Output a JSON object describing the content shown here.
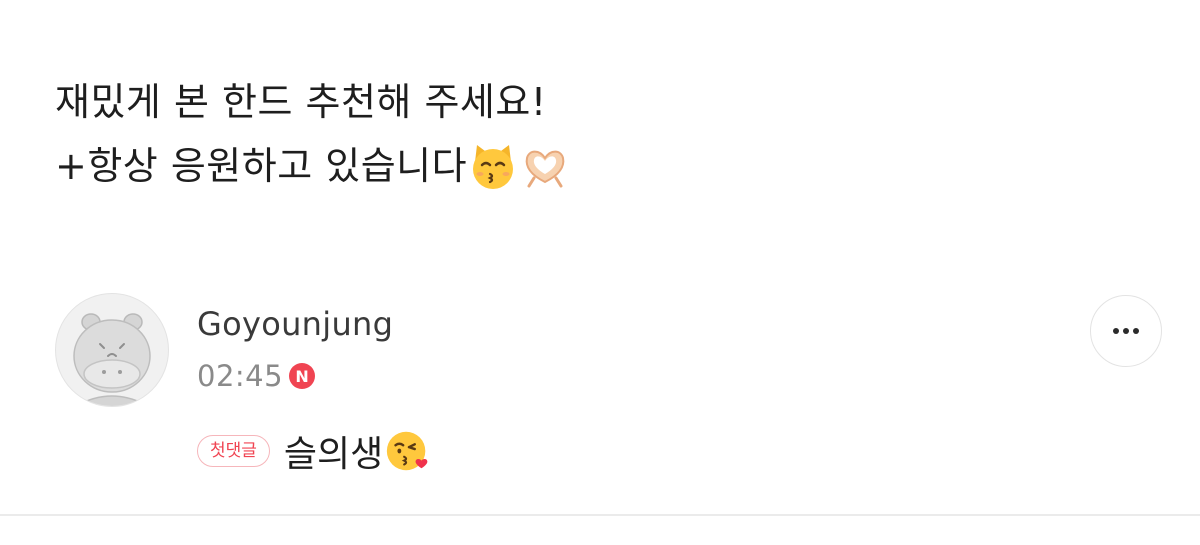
{
  "post": {
    "line1": "재밌게 본 한드 추천해 주세요!",
    "line2": "+항상 응원하고 있습니다"
  },
  "comment": {
    "author": "Goyounjung",
    "time": "02:45",
    "new_badge": "N",
    "first_comment_badge": "첫댓글",
    "text": "슬의생"
  },
  "icons": [
    "kissing-cat-emoji-icon",
    "heart-hands-emoji-icon",
    "kissing-face-heart-emoji-icon",
    "more-options-icon"
  ],
  "colors": {
    "accent": "#f04452",
    "badge_border": "#f6b6bb",
    "muted_text": "#8a8a8a"
  }
}
